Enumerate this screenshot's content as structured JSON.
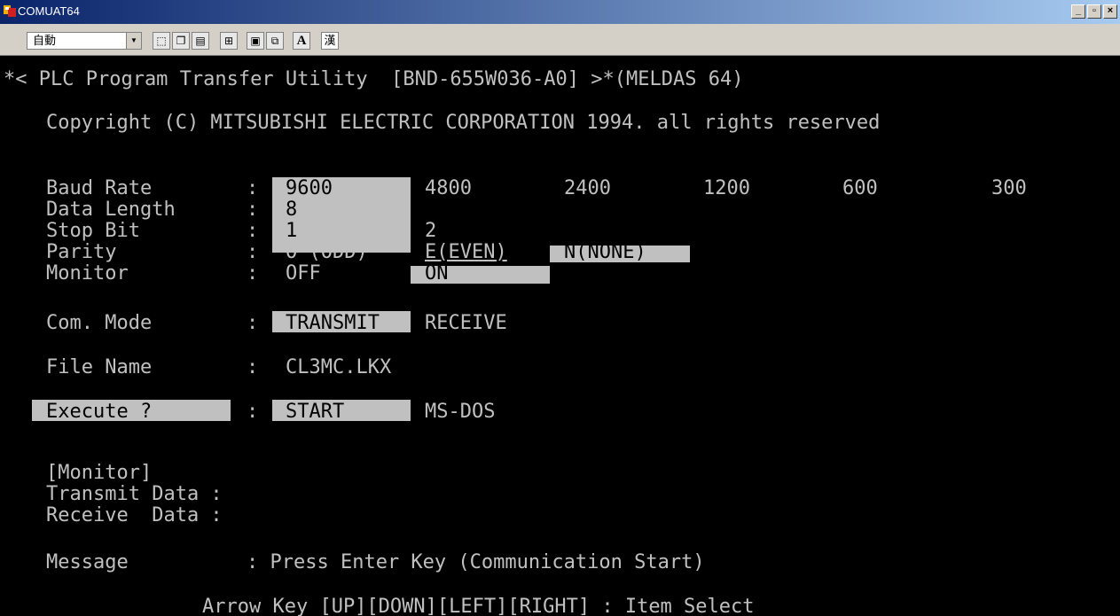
{
  "window": {
    "title": "COMUAT64"
  },
  "toolbar": {
    "font_value": "自動",
    "icons": [
      "mark-icon",
      "copy-icon",
      "paste-icon",
      "fullscreen-icon",
      "properties-icon",
      "background-icon",
      "font-icon",
      "kanji-icon"
    ],
    "font_btn_label": "A",
    "kanji_label": "漢"
  },
  "colors": {
    "fg": "#c0c0c0",
    "bg": "#000000",
    "highlight": "#c0c0c0"
  },
  "header": {
    "title_line": "*< PLC Program Transfer Utility  [BND-655W036-A0] >*(MELDAS 64)",
    "copyright": "Copyright (C) MITSUBISHI ELECTRIC CORPORATION 1994. all rights reserved"
  },
  "settings": {
    "baud": {
      "label": "Baud Rate",
      "options": [
        "9600",
        "4800",
        "2400",
        "1200",
        "600",
        "300"
      ],
      "selected": "9600"
    },
    "data_length": {
      "label": "Data Length",
      "options": [
        "8"
      ],
      "selected": "8"
    },
    "stop_bit": {
      "label": "Stop Bit",
      "options": [
        "1",
        "2"
      ],
      "selected": "1"
    },
    "parity": {
      "label": "Parity",
      "options": [
        "O (ODD)",
        "E(EVEN)",
        "N(NONE)"
      ],
      "selected": "N(NONE)"
    },
    "monitor": {
      "label": "Monitor",
      "options": [
        "OFF",
        "ON"
      ],
      "selected": "ON"
    },
    "separator": ":"
  },
  "com_mode": {
    "label": "Com. Mode",
    "options": [
      "TRANSMIT",
      "RECEIVE"
    ],
    "selected": "TRANSMIT"
  },
  "file_name": {
    "label": "File Name",
    "value": "CL3MC.LKX"
  },
  "execute": {
    "label": "Execute ?",
    "options": [
      "START",
      "MS-DOS"
    ],
    "selected": "START"
  },
  "monitor_section": {
    "header": "[Monitor]",
    "transmit": "Transmit Data :",
    "receive": "Receive  Data :"
  },
  "message": {
    "label": "Message",
    "text": ": Press Enter Key (Communication Start)"
  },
  "footer": {
    "hint": "Arrow Key [UP][DOWN][LEFT][RIGHT] : Item Select"
  }
}
